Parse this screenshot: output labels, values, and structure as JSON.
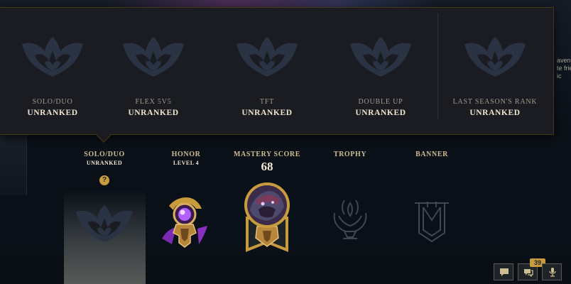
{
  "background": {
    "side_text": [
      "aven'",
      "te frie",
      "ic"
    ]
  },
  "ranked_popup": {
    "queues": [
      {
        "name": "SOLO/DUO",
        "rank": "UNRANKED",
        "emblem": "unranked-emblem-icon"
      },
      {
        "name": "FLEX 5V5",
        "rank": "UNRANKED",
        "emblem": "unranked-emblem-icon"
      },
      {
        "name": "TFT",
        "rank": "UNRANKED",
        "emblem": "unranked-emblem-icon"
      },
      {
        "name": "DOUBLE UP",
        "rank": "UNRANKED",
        "emblem": "unranked-emblem-icon"
      },
      {
        "name": "LAST SEASON'S RANK",
        "rank": "UNRANKED",
        "emblem": "unranked-emblem-icon"
      }
    ]
  },
  "profile": {
    "solo": {
      "title": "SOLO/DUO",
      "sub": "UNRANKED",
      "help": "?"
    },
    "honor": {
      "title": "HONOR",
      "sub": "LEVEL 4"
    },
    "mastery": {
      "title": "MASTERY SCORE",
      "value": "68"
    },
    "trophy": {
      "title": "TROPHY"
    },
    "banner": {
      "title": "BANNER"
    }
  },
  "toolbar": {
    "buttons": [
      "chat-icon",
      "notifications-icon",
      "microphone-icon"
    ],
    "notification_count": "39"
  },
  "colors": {
    "gold": "#c89b3c",
    "gold_text": "#cdbe91",
    "light_text": "#f0e6d2",
    "popup_bg": "#1a1c21",
    "popup_border": "#463714",
    "emblem": "#2a3344"
  }
}
